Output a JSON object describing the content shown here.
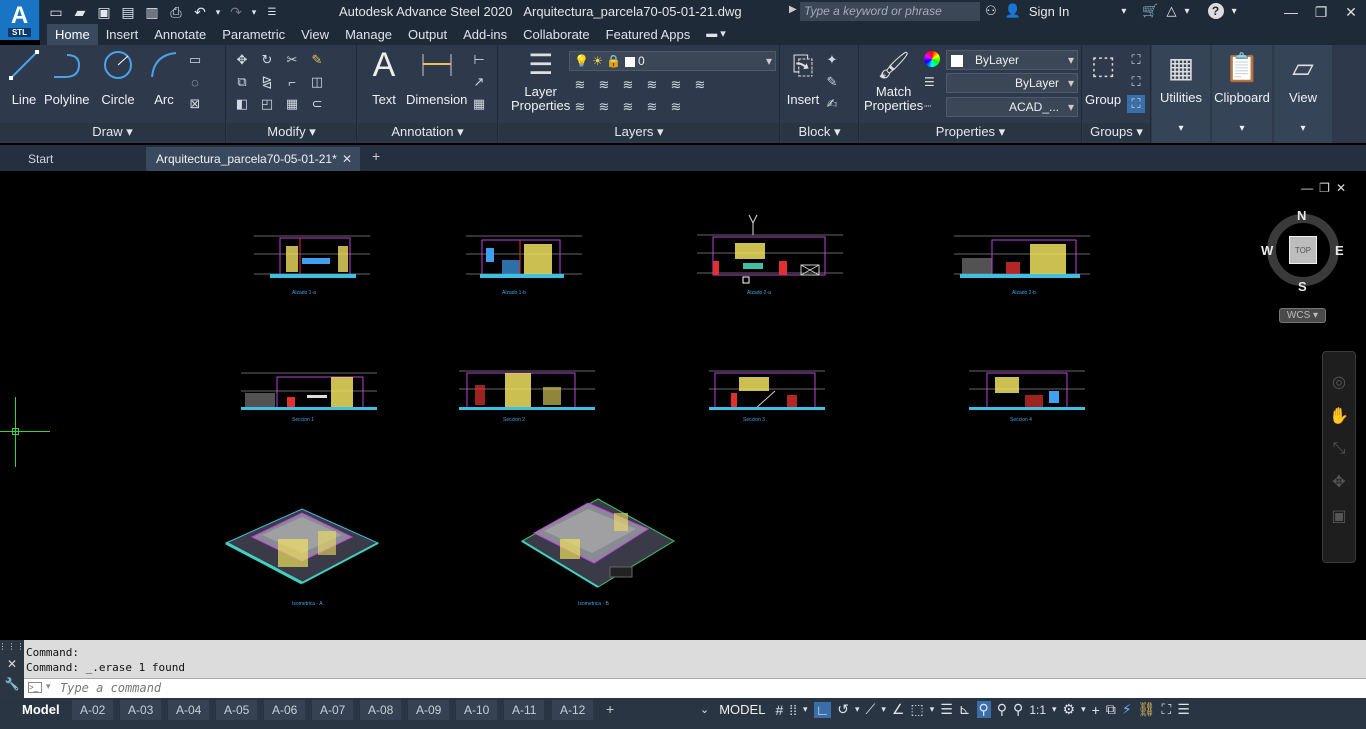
{
  "app": {
    "logo_text": "A",
    "logo_sub": "STL",
    "title": "Autodesk Advance Steel 2020",
    "filename": "Arquitectura_parcela70-05-01-21.dwg",
    "search_placeholder": "Type a keyword or phrase",
    "sign_in": "Sign In"
  },
  "menu_tabs": [
    "Home",
    "Insert",
    "Annotate",
    "Parametric",
    "View",
    "Manage",
    "Output",
    "Add-ins",
    "Collaborate",
    "Featured Apps"
  ],
  "ribbon": {
    "draw": {
      "label": "Draw",
      "line": "Line",
      "polyline": "Polyline",
      "circle": "Circle",
      "arc": "Arc"
    },
    "modify": {
      "label": "Modify"
    },
    "annotation": {
      "label": "Annotation",
      "text": "Text",
      "dimension": "Dimension"
    },
    "layers": {
      "label": "Layers",
      "layer_properties_1": "Layer",
      "layer_properties_2": "Properties",
      "current_layer": "0"
    },
    "block": {
      "label": "Block",
      "insert": "Insert"
    },
    "properties": {
      "label": "Properties",
      "match_1": "Match",
      "match_2": "Properties",
      "color": "ByLayer",
      "lineweight": "ByLayer",
      "linetype": "ACAD_..."
    },
    "groups": {
      "label": "Groups",
      "group": "Group"
    },
    "utilities": "Utilities",
    "clipboard": "Clipboard",
    "view": "View"
  },
  "doc_tabs": {
    "start": "Start",
    "active": "Arquitectura_parcela70-05-01-21*"
  },
  "drawings": {
    "elevations": [
      "Alzado 1-a",
      "Alzado 1-b",
      "Alzado 2-a",
      "Alzado 2-b"
    ],
    "sections": [
      "Seccion 1",
      "Seccion 2",
      "Seccion 3",
      "Seccion 4"
    ],
    "isometrics": [
      "Isometrica - A",
      "Isometrica - B"
    ]
  },
  "navcube": {
    "n": "N",
    "s": "S",
    "e": "E",
    "w": "W",
    "top": "TOP",
    "wcs": "WCS"
  },
  "command": {
    "history": [
      "Command:",
      "Command:  _.erase 1 found"
    ],
    "placeholder": "Type a command"
  },
  "layouts": [
    "Model",
    "A-02",
    "A-03",
    "A-04",
    "A-05",
    "A-06",
    "A-07",
    "A-08",
    "A-09",
    "A-10",
    "A-11",
    "A-12"
  ],
  "status": {
    "model": "MODEL",
    "scale": "1:1"
  }
}
